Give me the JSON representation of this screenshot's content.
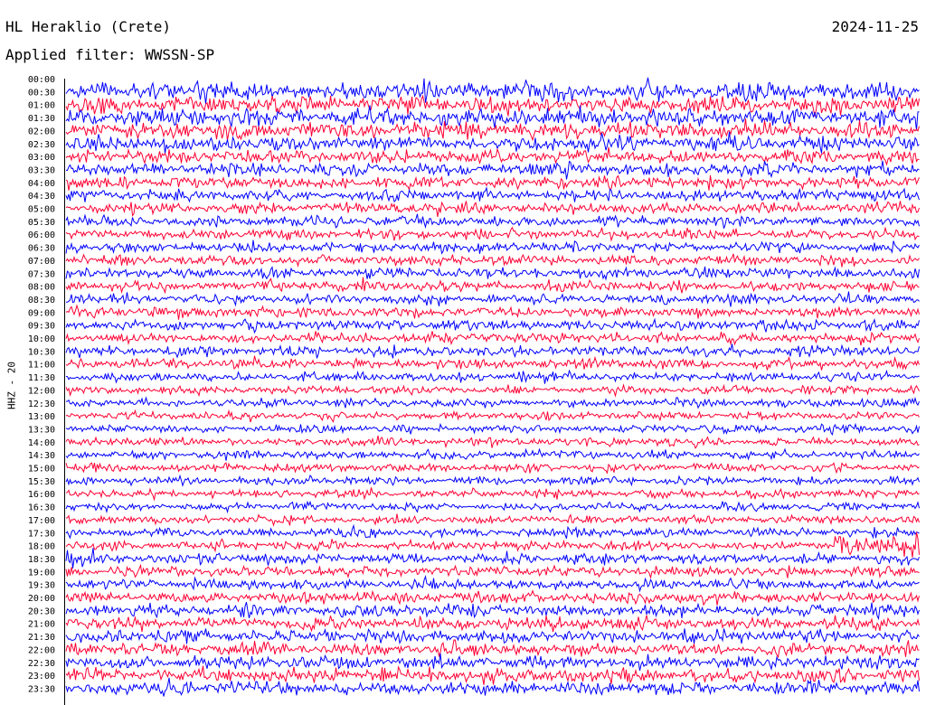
{
  "header": {
    "station": "HL Heraklio (Crete)",
    "date": "2024-11-25",
    "filter_label": "Applied filter: WWSSN-SP",
    "channel": "HHZ - 20"
  },
  "colors": {
    "trace_a": "#0000ff",
    "trace_b": "#ff0033",
    "axis": "#000000",
    "background": "#ffffff"
  },
  "chart_data": {
    "type": "helicorder",
    "ylabel": "HHZ - 20",
    "row_minutes": 30,
    "colors_alternate": [
      "#0000ff",
      "#ff0033"
    ],
    "time_labels": [
      "00:00",
      "00:30",
      "01:00",
      "01:30",
      "02:00",
      "02:30",
      "03:00",
      "03:30",
      "04:00",
      "04:30",
      "05:00",
      "05:30",
      "06:00",
      "06:30",
      "07:00",
      "07:30",
      "08:00",
      "08:30",
      "09:00",
      "09:30",
      "10:00",
      "10:30",
      "11:00",
      "11:30",
      "12:00",
      "12:30",
      "13:00",
      "13:30",
      "14:00",
      "14:30",
      "15:00",
      "15:30",
      "16:00",
      "16:30",
      "17:00",
      "17:30",
      "18:00",
      "18:30",
      "19:00",
      "19:30",
      "20:00",
      "20:30",
      "21:00",
      "21:30",
      "22:00",
      "22:30",
      "23:00",
      "23:30"
    ],
    "first_trace_row": 1,
    "relative_amplitude": [
      0,
      1.9,
      1.7,
      1.7,
      1.6,
      1.5,
      1.3,
      1.2,
      1.2,
      1.1,
      1.1,
      1.0,
      1.0,
      1.0,
      1.0,
      1.0,
      1.0,
      1.0,
      1.0,
      1.0,
      1.0,
      1.0,
      1.0,
      0.9,
      0.8,
      0.8,
      0.8,
      0.8,
      0.8,
      0.8,
      0.8,
      0.8,
      0.8,
      0.8,
      0.8,
      0.9,
      0.9,
      1.0,
      1.0,
      1.0,
      1.1,
      1.2,
      1.2,
      1.2,
      1.2,
      1.2,
      1.3,
      1.3
    ],
    "burst_events": [
      {
        "row": 36,
        "minute_start": 27,
        "minute_end": 30,
        "relative_amplitude": 2.5
      },
      {
        "row": 37,
        "minute_start": 0,
        "minute_end": 1,
        "relative_amplitude": 2.4
      }
    ]
  }
}
